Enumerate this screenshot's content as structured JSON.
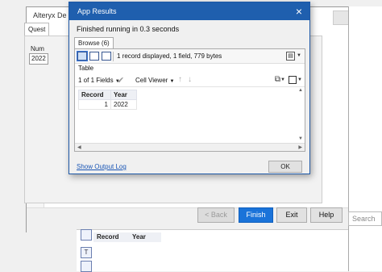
{
  "background_window": {
    "title": "Alteryx De",
    "question_tab": "Quest",
    "num_label": "Num",
    "num_value": "2022",
    "buttons": {
      "back": "< Back",
      "finish": "Finish",
      "exit": "Exit",
      "help": "Help"
    },
    "search_placeholder": "Search",
    "bottom_columns": [
      "Record",
      "Year"
    ]
  },
  "dialog": {
    "title": "App Results",
    "close": "×",
    "status": "Finished running in 0.3 seconds",
    "browse_tab": "Browse (6)",
    "info": "1 record displayed, 1 field, 779 bytes",
    "table_tab": "Table",
    "fields_dropdown": "1 of 1 Fields",
    "cell_viewer": "Cell Viewer",
    "table": {
      "headers": [
        "Record",
        "Year"
      ],
      "rows": [
        [
          "1",
          "2022"
        ]
      ]
    },
    "show_log": "Show Output Log",
    "ok": "OK"
  }
}
